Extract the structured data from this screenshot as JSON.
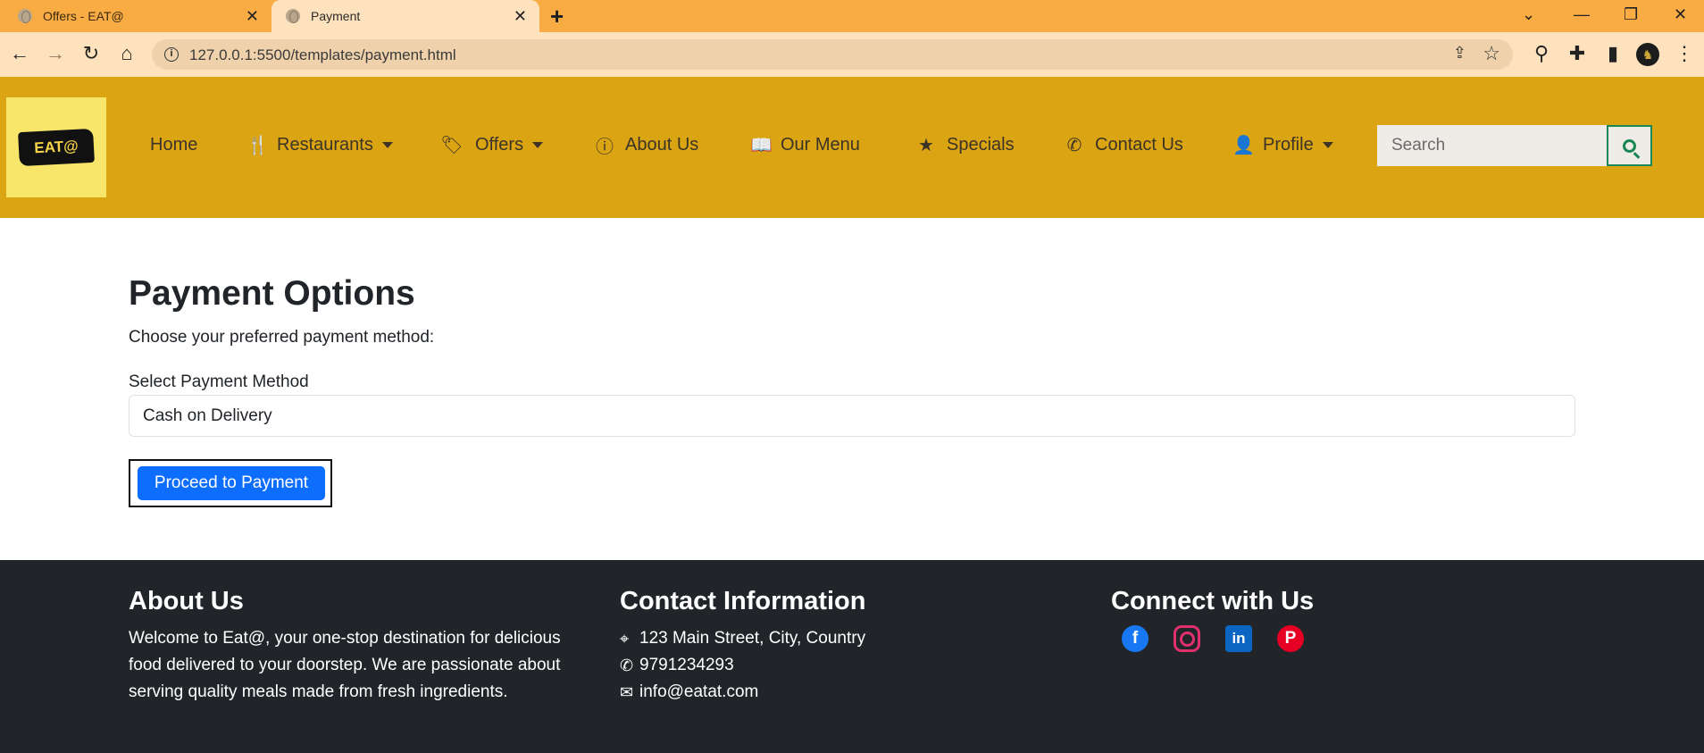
{
  "browser": {
    "tabs": [
      {
        "title": "Offers - EAT@",
        "active": false
      },
      {
        "title": "Payment",
        "active": true
      }
    ],
    "url": "127.0.0.1:5500/templates/payment.html",
    "tab_close": "✕",
    "new_tab": "+",
    "window_controls": {
      "chevron": "⌄",
      "minimize": "—",
      "restore": "❐",
      "close": "✕"
    },
    "nav_buttons": {
      "back": "←",
      "forward": "→",
      "reload": "↻",
      "home": "⌂"
    },
    "extensions": {
      "pin": "⚲",
      "puzzle": "✚",
      "sidebar": "▮",
      "menu": "⋮"
    }
  },
  "site": {
    "logo_text": "EAT@",
    "nav": [
      {
        "label": "Home",
        "icon": "none"
      },
      {
        "label": "Restaurants",
        "icon": "utensils-icon",
        "dropdown": true
      },
      {
        "label": "Offers",
        "icon": "tags-icon",
        "dropdown": true
      },
      {
        "label": "About Us",
        "icon": "info-circle-icon"
      },
      {
        "label": "Our Menu",
        "icon": "book-open-icon"
      },
      {
        "label": "Specials",
        "icon": "star-icon"
      },
      {
        "label": "Contact Us",
        "icon": "phone-icon"
      },
      {
        "label": "Profile",
        "icon": "user-icon",
        "dropdown": true
      }
    ],
    "search_placeholder": "Search",
    "colors": {
      "navbar": "#dba413",
      "logo_bg": "#f7e66a",
      "primary": "#0d6efd",
      "search_accent": "#198754",
      "footer": "#212529"
    }
  },
  "payment": {
    "title": "Payment Options",
    "subtitle": "Choose your preferred payment method:",
    "select_label": "Select Payment Method",
    "selected_method": "Cash on Delivery",
    "submit_label": "Proceed to Payment"
  },
  "footer": {
    "about": {
      "heading": "About Us",
      "text": "Welcome to Eat@, your one-stop destination for delicious food delivered to your doorstep. We are passionate about serving quality meals made from fresh ingredients."
    },
    "contact": {
      "heading": "Contact Information",
      "address": "123 Main Street, City, Country",
      "phone": "9791234293",
      "email": "info@eatat.com"
    },
    "connect": {
      "heading": "Connect with Us",
      "networks": [
        "facebook-icon",
        "instagram-icon",
        "linkedin-icon",
        "pinterest-icon"
      ]
    }
  }
}
